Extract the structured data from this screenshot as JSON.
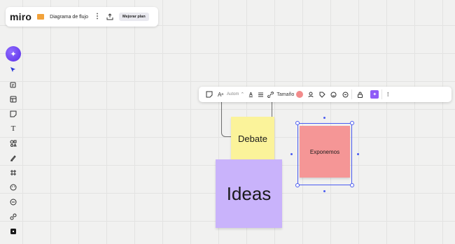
{
  "header": {
    "logo": "miro",
    "board_name": "Diagrama de flujo",
    "menu_icon": "kebab-icon",
    "share_icon": "upload-icon",
    "upgrade_label": "Mejorar plan"
  },
  "left_toolbar": {
    "ai_button_icon": "sparkle-icon",
    "tools": [
      "select-arrow-icon",
      "templates-icon",
      "table-layout-icon",
      "sticky-note-icon",
      "text-icon",
      "shapes-icon",
      "pen-icon",
      "frame-icon",
      "sticker-icon",
      "comment-icon",
      "connectors-icon",
      "more-apps-icon"
    ]
  },
  "context_toolbar": {
    "font_size_mode": "Autom",
    "size_label": "Tamaño",
    "fill_color": "#f28b8b",
    "accent_color": "#8f5cf7"
  },
  "canvas": {
    "notes": {
      "debate": "Debate",
      "ideas": "Ideas",
      "exponemos": "Exponemos"
    },
    "colors": {
      "yellow": "#fbf39a",
      "purple": "#c9b3fb",
      "red": "#f59696",
      "selection": "#4a5bf0"
    }
  }
}
